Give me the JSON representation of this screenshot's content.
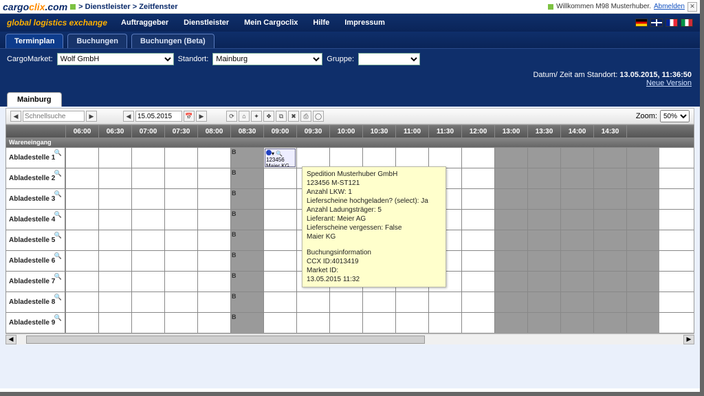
{
  "header": {
    "logo_a": "cargo",
    "logo_b": "clix",
    "logo_c": ".com",
    "crumb1": "Dienstleister",
    "crumb2": "Zeitfenster",
    "welcome": "Willkommen M98 Musterhuber.",
    "logout": "Abmelden"
  },
  "nav": {
    "tagline": "global logistics exchange",
    "items": [
      "Auftraggeber",
      "Dienstleister",
      "Mein Cargoclix",
      "Hilfe",
      "Impressum"
    ]
  },
  "tabs1": [
    "Terminplan",
    "Buchungen",
    "Buchungen (Beta)"
  ],
  "filters": {
    "market_label": "CargoMarket:",
    "market_value": "Wolf GmbH",
    "location_label": "Standort:",
    "location_value": "Mainburg",
    "group_label": "Gruppe:",
    "group_value": ""
  },
  "datum": {
    "prefix": "Datum/ Zeit am Standort:",
    "value": "13.05.2015, 11:36:50",
    "newver": "Neue Version"
  },
  "loc_tab": "Mainburg",
  "toolbar": {
    "search_placeholder": "Schnellsuche",
    "date_value": "15.05.2015",
    "zoom_label": "Zoom:",
    "zoom_value": "50%"
  },
  "time_cols": [
    "06:00",
    "06:30",
    "07:00",
    "07:30",
    "08:00",
    "08:30",
    "09:00",
    "09:30",
    "10:00",
    "10:30",
    "11:00",
    "11:30",
    "12:00",
    "13:00",
    "13:30",
    "14:00",
    "14:30"
  ],
  "section": "Wareneingang",
  "rows": [
    "Abladestelle 1",
    "Abladestelle 2",
    "Abladestelle 3",
    "Abladestelle 4",
    "Abladestelle 5",
    "Abladestelle 6",
    "Abladestelle 7",
    "Abladestelle 8",
    "Abladestelle 9"
  ],
  "b_tag": "B",
  "booking_cell": {
    "id": "123456",
    "carrier": "Maier KG M"
  },
  "tooltip": {
    "l1": "Spedition Musterhuber GmbH",
    "l2": "123456 M-ST121",
    "l3": "Anzahl LKW: 1",
    "l4": "Lieferscheine hochgeladen? (select): Ja",
    "l5": "Anzahl Ladungsträger: 5",
    "l6": "Lieferant: Meier AG",
    "l7": "Lieferscheine vergessen: False",
    "l8": "Maier KG",
    "l9": "Buchungsinformation",
    "l10": "CCX ID:4013419",
    "l11": "Market ID:",
    "l12": "13.05.2015 11:32"
  }
}
